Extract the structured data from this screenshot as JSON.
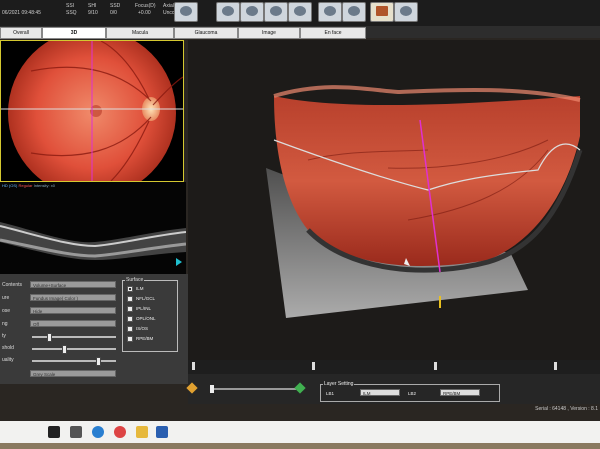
{
  "status": {
    "datetime": "06/2021 09:48:45",
    "fields": [
      {
        "label": "SSI",
        "value": "SSQ"
      },
      {
        "label": "SHI",
        "value": "9/10"
      },
      {
        "label": "SSD",
        "value": "0/0"
      },
      {
        "label": "Focus(D)",
        "value": "+0.00"
      },
      {
        "label": "Axial(mm)",
        "value": "Uncorrected"
      }
    ]
  },
  "tabs": [
    {
      "label": "Overall"
    },
    {
      "label": "3D"
    },
    {
      "label": "Macula"
    },
    {
      "label": "Glaucoma"
    },
    {
      "label": "Image"
    },
    {
      "label": "En face"
    }
  ],
  "bscan": {
    "eye": "HD (OS)",
    "mode": "Regular",
    "intensity": "Intensity: x0"
  },
  "controls": {
    "rows": [
      {
        "label": "Contents",
        "value": "Volume+Surface"
      },
      {
        "label": "ure",
        "value": "Fundus Image( Color )"
      },
      {
        "label": "ose",
        "value": "Hide"
      },
      {
        "label": "ng",
        "value": "Off"
      },
      {
        "label": "ty",
        "value": ""
      },
      {
        "label": "shold",
        "value": ""
      },
      {
        "label": "uality",
        "value": ""
      },
      {
        "label": "",
        "value": "Grey Scale"
      }
    ],
    "sliders": [
      {
        "level": 0.2
      },
      {
        "level": 0.38
      },
      {
        "level": 0.78
      }
    ]
  },
  "surface": {
    "title": "Surface",
    "items": [
      {
        "label": "ILM",
        "checked": true
      },
      {
        "label": "NFL/GCL",
        "checked": false
      },
      {
        "label": "IPL/INL",
        "checked": false
      },
      {
        "label": "OPL/ONL",
        "checked": false
      },
      {
        "label": "IS/OS",
        "checked": false
      },
      {
        "label": "RPE/BM",
        "checked": false
      }
    ]
  },
  "layer_setting": {
    "title": "Layer Setting",
    "lb1_label": "LB1",
    "lb1_value": "ILM",
    "lb2_label": "LB2",
    "lb2_value": "RPE/BM"
  },
  "serial": "Serial : 64148 , Version : 8.1",
  "colors": {
    "accent_tab": "#ffffff",
    "magenta_line": "#e030d0",
    "panel_border": "#d4c830"
  }
}
